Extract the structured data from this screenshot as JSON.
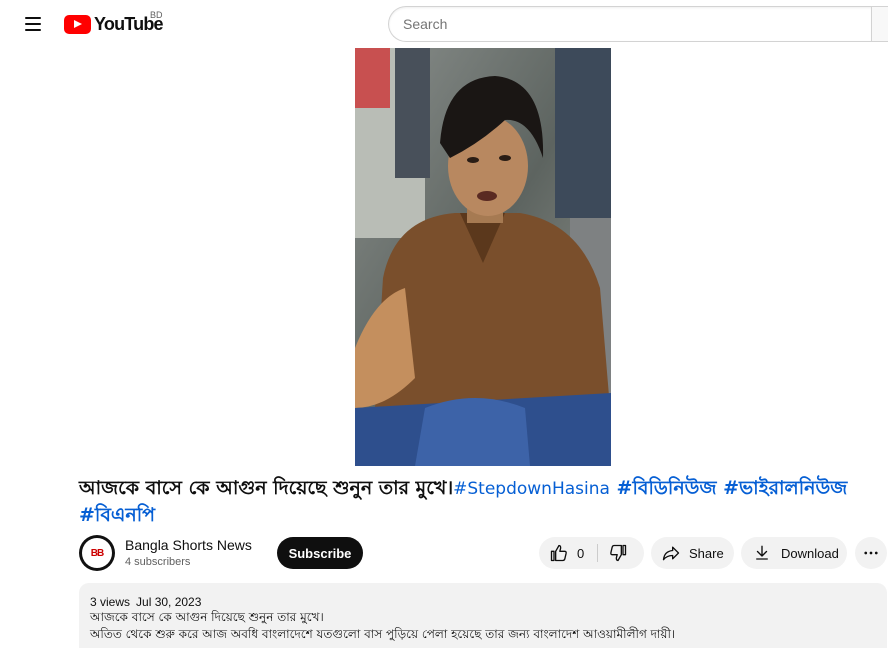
{
  "masthead": {
    "logo_text": "YouTube",
    "country_code": "BD",
    "search_placeholder": "Search"
  },
  "video": {
    "title_main": "আজকে বাসে কে আগুন দিয়েছে শুনুন তার মুখে।",
    "hashtags": [
      "#StepdownHasina",
      "#বিডিনিউজ",
      "#ভাইরালনিউজ",
      "#বিএনপি"
    ]
  },
  "channel": {
    "name": "Bangla Shorts News",
    "subscribers": "4 subscribers",
    "avatar_text": "BB",
    "subscribe_label": "Subscribe"
  },
  "actions": {
    "like_count": "0",
    "share_label": "Share",
    "download_label": "Download"
  },
  "description": {
    "views": "3 views",
    "date": "Jul 30, 2023",
    "lines": [
      "আজকে বাসে কে আগুন দিয়েছে শুনুন তার মুখে।",
      "অতিত থেকে শুরু করে আজ অবধি বাংলাদেশে যতগুলো বাস পুড়িয়ে পেলা হয়েছে তার জন্য বাংলাদেশ আওয়ামীলীগ দায়ী।"
    ]
  },
  "colors": {
    "brand_red": "#ff0000",
    "link_blue": "#065fd4",
    "subscribe_bg": "#0f0f0f"
  },
  "icons": [
    "menu-icon",
    "youtube-logo-icon",
    "like-icon",
    "dislike-icon",
    "share-icon",
    "download-icon",
    "more-icon"
  ]
}
